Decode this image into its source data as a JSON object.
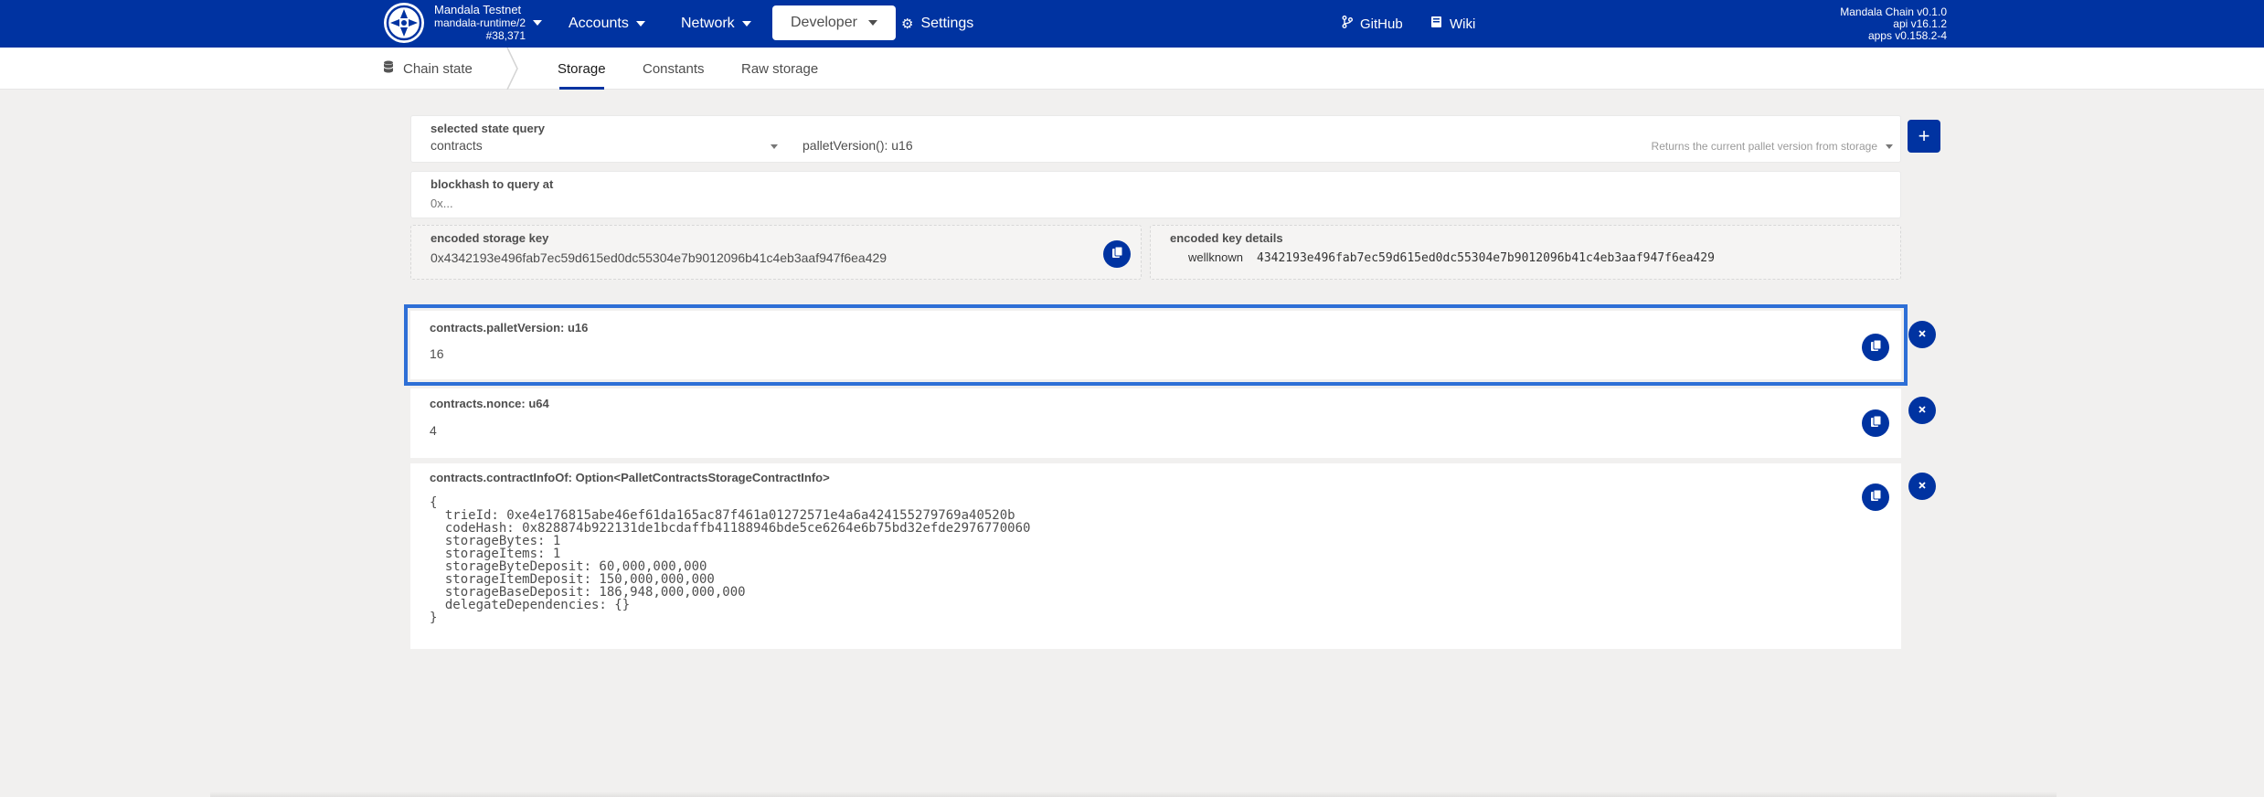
{
  "topbar": {
    "chain_name": "Mandala Testnet",
    "runtime": "mandala-runtime/2",
    "block_number": "#38,371",
    "menu": {
      "accounts": "Accounts",
      "network": "Network",
      "developer": "Developer",
      "settings": "Settings"
    },
    "links": {
      "github": "GitHub",
      "wiki": "Wiki"
    },
    "versions": {
      "chain": "Mandala Chain v0.1.0",
      "api": "api v16.1.2",
      "apps": "apps v0.158.2-4"
    }
  },
  "subnav": {
    "section": "Chain state",
    "tabs": {
      "storage": "Storage",
      "constants": "Constants",
      "raw": "Raw storage"
    },
    "active_tab": "Storage"
  },
  "query": {
    "selected_label": "selected state query",
    "module": "contracts",
    "method": "palletVersion(): u16",
    "method_doc": "Returns the current pallet version from storage",
    "add_label": "+"
  },
  "blockhash": {
    "label": "blockhash to query at",
    "placeholder": "0x..."
  },
  "encoded": {
    "key_label": "encoded storage key",
    "key_value": "0x4342193e496fab7ec59d615ed0dc55304e7b9012096b41c4eb3aaf947f6ea429",
    "details_label": "encoded key details",
    "details_tag": "wellknown",
    "details_value": "4342193e496fab7ec59d615ed0dc55304e7b9012096b41c4eb3aaf947f6ea429"
  },
  "results": [
    {
      "label": "contracts.palletVersion: u16",
      "value": "16"
    },
    {
      "label": "contracts.nonce: u64",
      "value": "4"
    },
    {
      "label": "contracts.contractInfoOf: Option<PalletContractsStorageContractInfo>",
      "value": "{\n  trieId: 0xe4e176815abe46ef61da165ac87f461a01272571e4a6a424155279769a40520b\n  codeHash: 0x828874b922131de1bcdaffb41188946bde5ce6264e6b75bd32efde2976770060\n  storageBytes: 1\n  storageItems: 1\n  storageByteDeposit: 60,000,000,000\n  storageItemDeposit: 150,000,000,000\n  storageBaseDeposit: 186,948,000,000,000\n  delegateDependencies: {}\n}"
    }
  ],
  "colors": {
    "brand": "#0033a1",
    "highlight": "#2e6fd6",
    "background": "#f1f0ef"
  }
}
